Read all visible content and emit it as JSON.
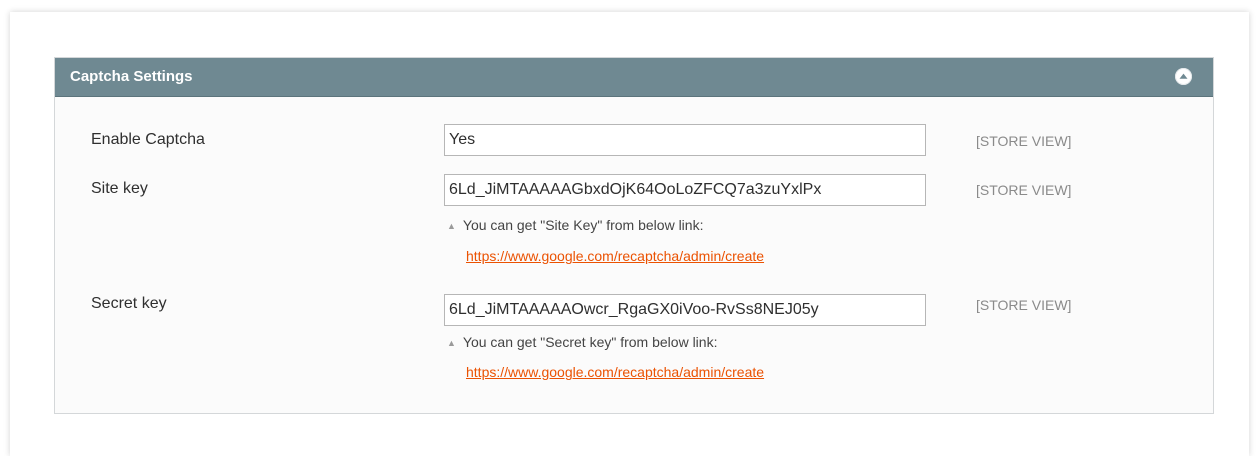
{
  "section": {
    "title": "Captcha Settings",
    "collapse_icon": "chevron-up-icon"
  },
  "fields": [
    {
      "label": "Enable Captcha",
      "value": "Yes",
      "scope": "[STORE VIEW]"
    },
    {
      "label": "Site key",
      "value": "6Ld_JiMTAAAAAGbxdOjK64OoLoZFCQ7a3zuYxlPx",
      "scope": "[STORE VIEW]",
      "note": "You can get \"Site Key\" from below link:",
      "link": "https://www.google.com/recaptcha/admin/create"
    },
    {
      "label": "Secret key",
      "value": "6Ld_JiMTAAAAAOwcr_RgaGX0iVoo-RvSs8NEJ05y",
      "scope": "[STORE VIEW]",
      "note": "You can get \"Secret key\" from below link:",
      "link": "https://www.google.com/recaptcha/admin/create"
    }
  ],
  "colors": {
    "header_bg": "#6f8992",
    "link": "#eb5202",
    "scope_text": "#8a8a8a"
  }
}
